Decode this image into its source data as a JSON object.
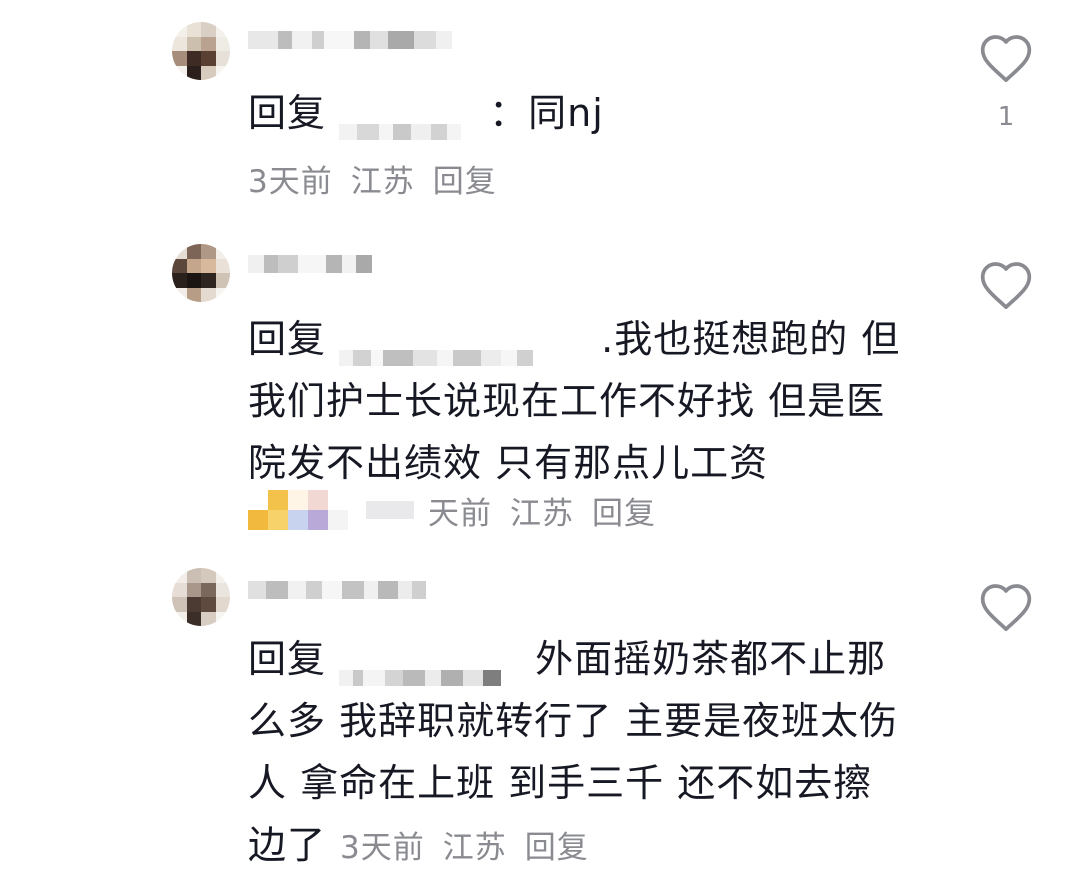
{
  "replies": [
    {
      "reply_prefix": "回复",
      "colon": "：",
      "text": "同nj",
      "meta": {
        "time": "3天前",
        "location": "江苏",
        "reply_label": "回复"
      },
      "like_count": "1"
    },
    {
      "reply_prefix": "回复",
      "colon": ".",
      "text": "我也挺想跑的 但我们护士长说现在工作不好找 但是医院发不出绩效 只有那点儿工资",
      "meta": {
        "time": "天前",
        "location": "江苏",
        "reply_label": "回复"
      },
      "like_count": ""
    },
    {
      "reply_prefix": "回复",
      "colon": "",
      "text": "外面摇奶茶都不止那么多 我辞职就转行了 主要是夜班太伤人 拿命在上班 到手三千 还不如去擦边了",
      "meta": {
        "time": "3天前",
        "location": "江苏",
        "reply_label": "回复"
      },
      "like_count": ""
    }
  ],
  "icons": {
    "like": "heart-outline-icon"
  },
  "colors": {
    "text": "#161823",
    "meta": "#8a8b91"
  }
}
